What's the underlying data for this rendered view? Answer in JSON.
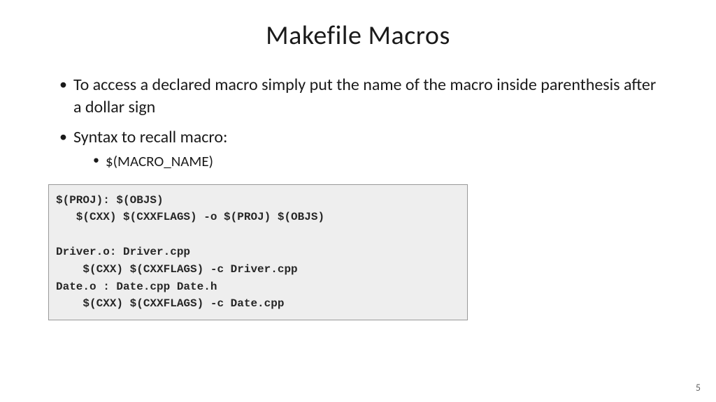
{
  "title": "Makefile Macros",
  "bullets": {
    "b1": "To access a declared macro simply put the name of the macro inside parenthesis after a dollar sign",
    "b2": "Syntax to recall macro:",
    "b2_sub1": "$(MACRO_NAME)"
  },
  "code": "$(PROJ): $(OBJS)\n   $(CXX) $(CXXFLAGS) -o $(PROJ) $(OBJS)\n\nDriver.o: Driver.cpp\n    $(CXX) $(CXXFLAGS) -c Driver.cpp\nDate.o : Date.cpp Date.h\n    $(CXX) $(CXXFLAGS) -c Date.cpp",
  "page_number": "5"
}
